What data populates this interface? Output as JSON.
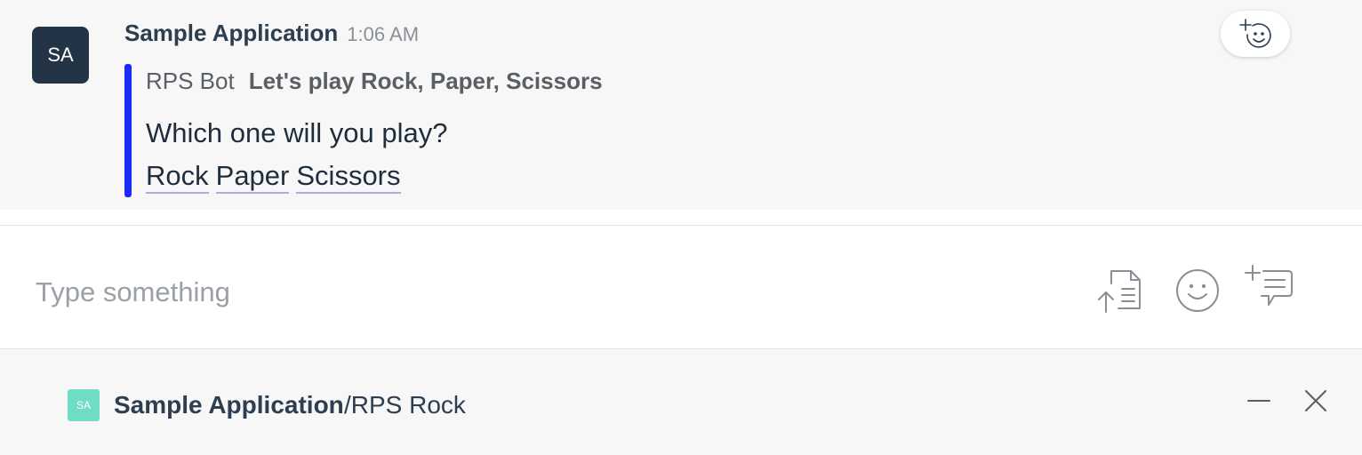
{
  "message": {
    "avatar_initials": "SA",
    "sender": "Sample Application",
    "time": "1:06 AM",
    "attachment": {
      "bot_name": "RPS Bot",
      "title": "Let's play Rock, Paper, Scissors",
      "text": "Which one will you play?",
      "bar_color": "#1a2cf5",
      "actions": [
        {
          "label": "Rock"
        },
        {
          "label": "Paper"
        },
        {
          "label": "Scissors"
        }
      ]
    }
  },
  "composer": {
    "placeholder": "Type something",
    "value": ""
  },
  "active_app": {
    "avatar_initials": "SA",
    "avatar_color": "#6fdcc6",
    "name": "Sample Application",
    "command": "/RPS Rock"
  },
  "icons": {
    "reaction": "add-reaction-icon",
    "upload": "file-upload-icon",
    "emoji": "emoji-icon",
    "snippet": "add-snippet-icon",
    "minimize": "minimize-icon",
    "close": "close-icon"
  }
}
